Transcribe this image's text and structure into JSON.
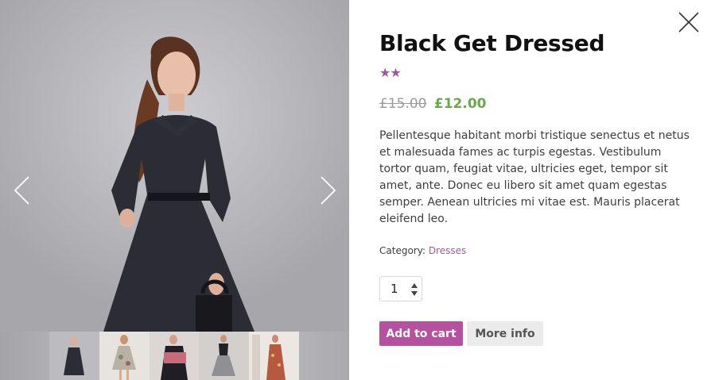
{
  "product": {
    "title": "Black Get Dressed",
    "rating_stars": "★★",
    "rating": 2,
    "old_price": "£15.00",
    "price": "£12.00",
    "description": "Pellentesque habitant morbi tristique senectus et netus et malesuada fames ac turpis egestas. Vestibulum tortor quam, feugiat vitae, ultricies eget, tempor sit amet, ante. Donec eu libero sit amet quam egestas semper. Aenean ultricies mi vitae est. Mauris placerat eleifend leo.",
    "category_label": "Category:",
    "category": "Dresses",
    "quantity": "1"
  },
  "buttons": {
    "add_to_cart": "Add to cart",
    "more_info": "More info"
  },
  "gallery": {
    "thumbnail_count": 5,
    "active_thumbnail": 1
  },
  "colors": {
    "accent": "#b5519f",
    "rating": "#a3579b",
    "sale_price": "#6aa84f"
  },
  "icons": [
    "chevron-left-icon",
    "chevron-right-icon",
    "close-icon",
    "spinner-icon"
  ]
}
